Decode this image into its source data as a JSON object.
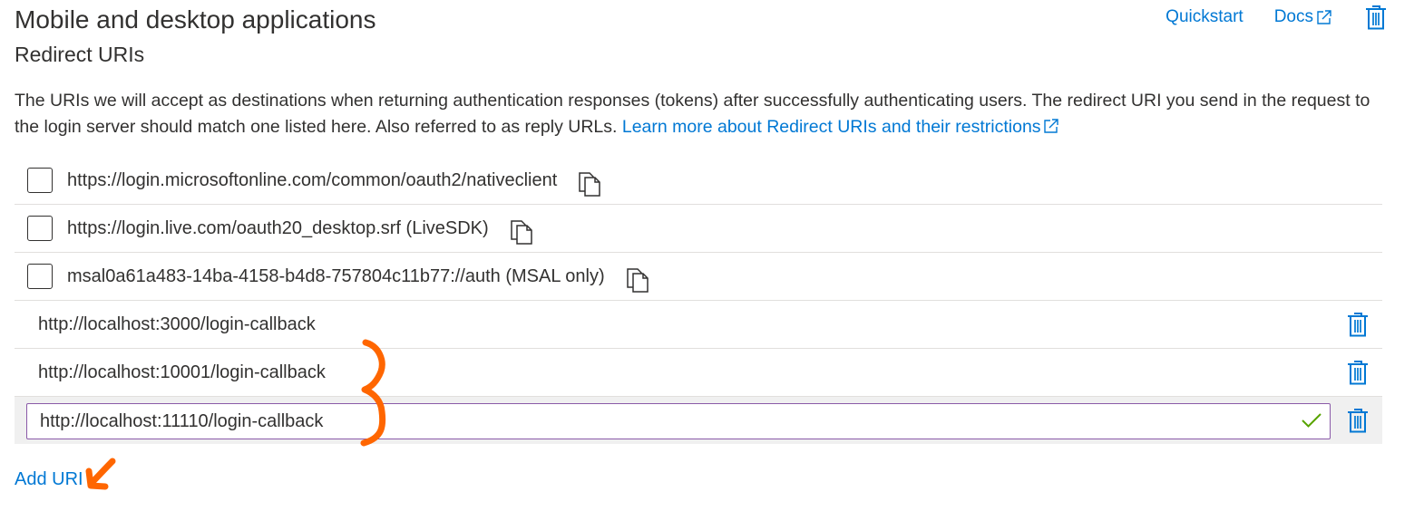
{
  "header": {
    "title": "Mobile and desktop applications",
    "subtitle": "Redirect URIs",
    "quickstart_label": "Quickstart",
    "docs_label": "Docs"
  },
  "description": {
    "text": "The URIs we will accept as destinations when returning authentication responses (tokens) after successfully authenticating users. The redirect URI you send in the request to the login server should match one listed here. Also referred to as reply URLs.",
    "link_text": "Learn more about Redirect URIs and their restrictions"
  },
  "suggested_uris": [
    {
      "uri": "https://login.microsoftonline.com/common/oauth2/nativeclient",
      "checked": false
    },
    {
      "uri": "https://login.live.com/oauth20_desktop.srf (LiveSDK)",
      "checked": false
    },
    {
      "uri": "msal0a61a483-14ba-4158-b4d8-757804c11b77://auth (MSAL only)",
      "checked": false
    }
  ],
  "custom_uris": [
    {
      "uri": "http://localhost:3000/login-callback"
    },
    {
      "uri": "http://localhost:10001/login-callback"
    }
  ],
  "editing_uri": {
    "value": "http://localhost:11110/login-callback",
    "valid": true
  },
  "add_uri_label": "Add URI",
  "colors": {
    "link": "#0078d4",
    "text": "#323130",
    "valid_check": "#57a300",
    "annotation": "#ff6600",
    "input_border": "#8a5aa8",
    "editing_row_bg": "#f0f0f0"
  },
  "icons": {
    "docs": "external-link-icon",
    "delete": "trash-icon",
    "copy": "copy-icon",
    "valid": "checkmark-icon"
  }
}
